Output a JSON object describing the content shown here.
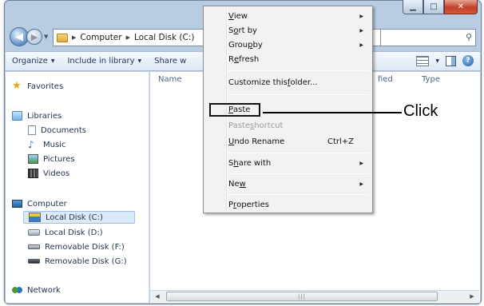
{
  "nav": {
    "breadcrumbs": [
      "Computer",
      "Local Disk (C:)"
    ]
  },
  "toolbar": {
    "organize": "Organize",
    "include_in_library": "Include in library",
    "share_with": "Share w"
  },
  "nav_pane": {
    "favorites": "Favorites",
    "libraries": "Libraries",
    "library_items": [
      "Documents",
      "Music",
      "Pictures",
      "Videos"
    ],
    "computer": "Computer",
    "drives": [
      "Local Disk (C:)",
      "Local Disk (D:)",
      "Removable Disk (F:)",
      "Removable Disk (G:)"
    ],
    "network": "Network"
  },
  "content": {
    "columns": [
      "Name",
      "fied",
      "Type"
    ]
  },
  "context_menu": {
    "items": [
      {
        "pre": "",
        "u": "V",
        "post": "iew",
        "submenu": true
      },
      {
        "pre": "S",
        "u": "o",
        "post": "rt by",
        "submenu": true
      },
      {
        "pre": "Grou",
        "u": "p",
        "post": " by",
        "submenu": true
      },
      {
        "pre": "R",
        "u": "e",
        "post": "fresh",
        "submenu": false
      },
      {
        "pre": "Customize this ",
        "u": "f",
        "post": "older...",
        "submenu": false
      },
      {
        "pre": "",
        "u": "P",
        "post": "aste",
        "submenu": false
      },
      {
        "pre": "Paste ",
        "u": "s",
        "post": "hortcut",
        "submenu": false
      },
      {
        "pre": "",
        "u": "U",
        "post": "ndo Rename",
        "submenu": false,
        "shortcut": "Ctrl+Z"
      },
      {
        "pre": "S",
        "u": "h",
        "post": "are with",
        "submenu": true
      },
      {
        "pre": "Ne",
        "u": "w",
        "post": "",
        "submenu": true
      },
      {
        "pre": "P",
        "u": "r",
        "post": "operties",
        "submenu": false
      }
    ],
    "highlighted_item": "Paste",
    "disabled_item": "Paste shortcut"
  },
  "annotation": {
    "label": "Click"
  },
  "colors": {
    "window_frame": "#b8cde2",
    "menu_background": "#f2f2f2",
    "selected_item": "#dce9f7",
    "close_button": "#c0402a"
  },
  "icons": [
    "back-arrow-icon",
    "forward-arrow-icon",
    "folder-icon",
    "search-icon",
    "views-icon",
    "preview-pane-icon",
    "help-icon",
    "star-icon",
    "library-icon",
    "document-icon",
    "music-icon",
    "pictures-icon",
    "videos-icon",
    "computer-icon",
    "drive-icon",
    "removable-disk-icon",
    "network-icon"
  ]
}
